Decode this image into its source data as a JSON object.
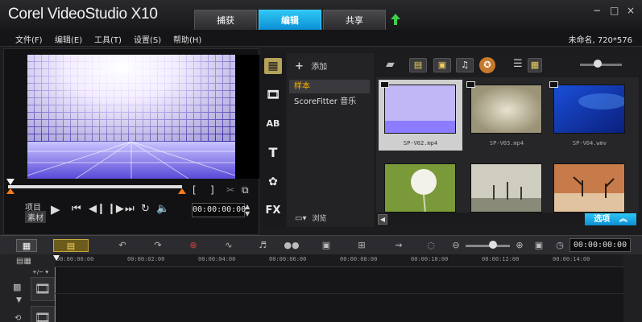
{
  "app": {
    "title": "Corel VideoStudio X10",
    "tabs": [
      {
        "label": "捕获",
        "active": false
      },
      {
        "label": "编辑",
        "active": true
      },
      {
        "label": "共享",
        "active": false
      }
    ],
    "window_controls": [
      "−",
      "□",
      "×"
    ],
    "accent_color": "#1ab0ea"
  },
  "menu": {
    "items": [
      "文件(F)",
      "编辑(E)",
      "工具(T)",
      "设置(S)",
      "帮助(H)"
    ],
    "project_info": "未命名, 720*576"
  },
  "preview": {
    "mode_project": "项目",
    "mode_material": "素材",
    "trim_in": "[",
    "trim_out": "]",
    "timecode": "00:00:00:00"
  },
  "library": {
    "add_label": "添加",
    "categories": [
      "样本",
      "ScoreFitter 音乐"
    ],
    "browse_label": "浏览",
    "options_label": "选项",
    "side_icons": [
      "media-icon",
      "instant-project-icon",
      "transition-icon",
      "title-icon",
      "graphic-icon",
      "filter-icon"
    ],
    "fx_label": "FX",
    "title_glyph": "T",
    "transition_glyph": "AB",
    "thumbnails": [
      {
        "caption": "SP-V02.mp4",
        "selected": true
      },
      {
        "caption": "SP-V03.mp4",
        "selected": false
      },
      {
        "caption": "SP-V04.wmv",
        "selected": false
      },
      {
        "caption": "",
        "selected": false
      },
      {
        "caption": "",
        "selected": false
      },
      {
        "caption": "",
        "selected": false
      }
    ]
  },
  "timeline": {
    "timecode": "00:00:00:00",
    "ruler_ticks": [
      "00:00:00:00",
      "00:00:02:00",
      "00:00:04:00",
      "00:00:06:00",
      "00:00:08:00",
      "00:00:10:00",
      "00:00:12:00",
      "00:00:14:00"
    ],
    "track_toggle_label": "+/− ▾"
  }
}
